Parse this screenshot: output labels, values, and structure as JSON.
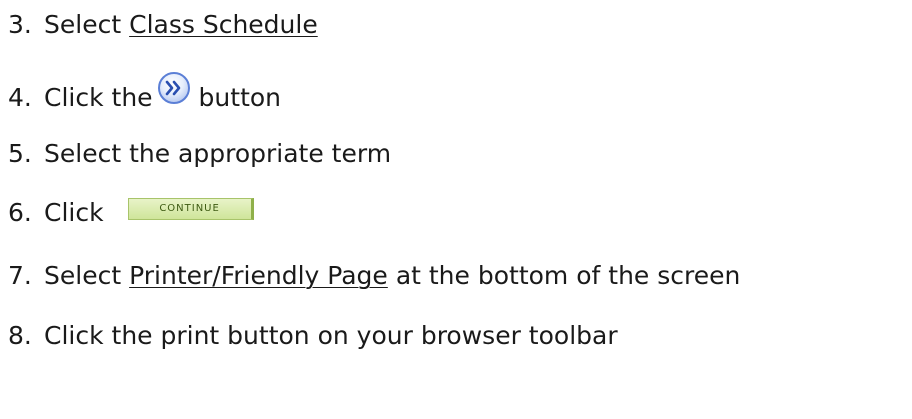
{
  "steps": [
    {
      "number": "3.",
      "text_before": "Select",
      "link": "Class Schedule",
      "text_after": ""
    },
    {
      "number": "4.",
      "text_before": "Click the",
      "button_icon": "double-chevron-right-icon",
      "text_after": "button"
    },
    {
      "number": "5.",
      "text": "Select the appropriate term"
    },
    {
      "number": "6.",
      "text_before": "Click",
      "button_label": "CONTINUE"
    },
    {
      "number": "7.",
      "text_before": "Select",
      "link": "Printer/Friendly Page",
      "text_after": "at the bottom of the screen"
    },
    {
      "number": "8.",
      "text": "Click the print button on your browser toolbar"
    }
  ],
  "colors": {
    "text": "#1a1a1a",
    "circle_button": "#5b7fd6",
    "continue_button": "#cfe59a"
  }
}
